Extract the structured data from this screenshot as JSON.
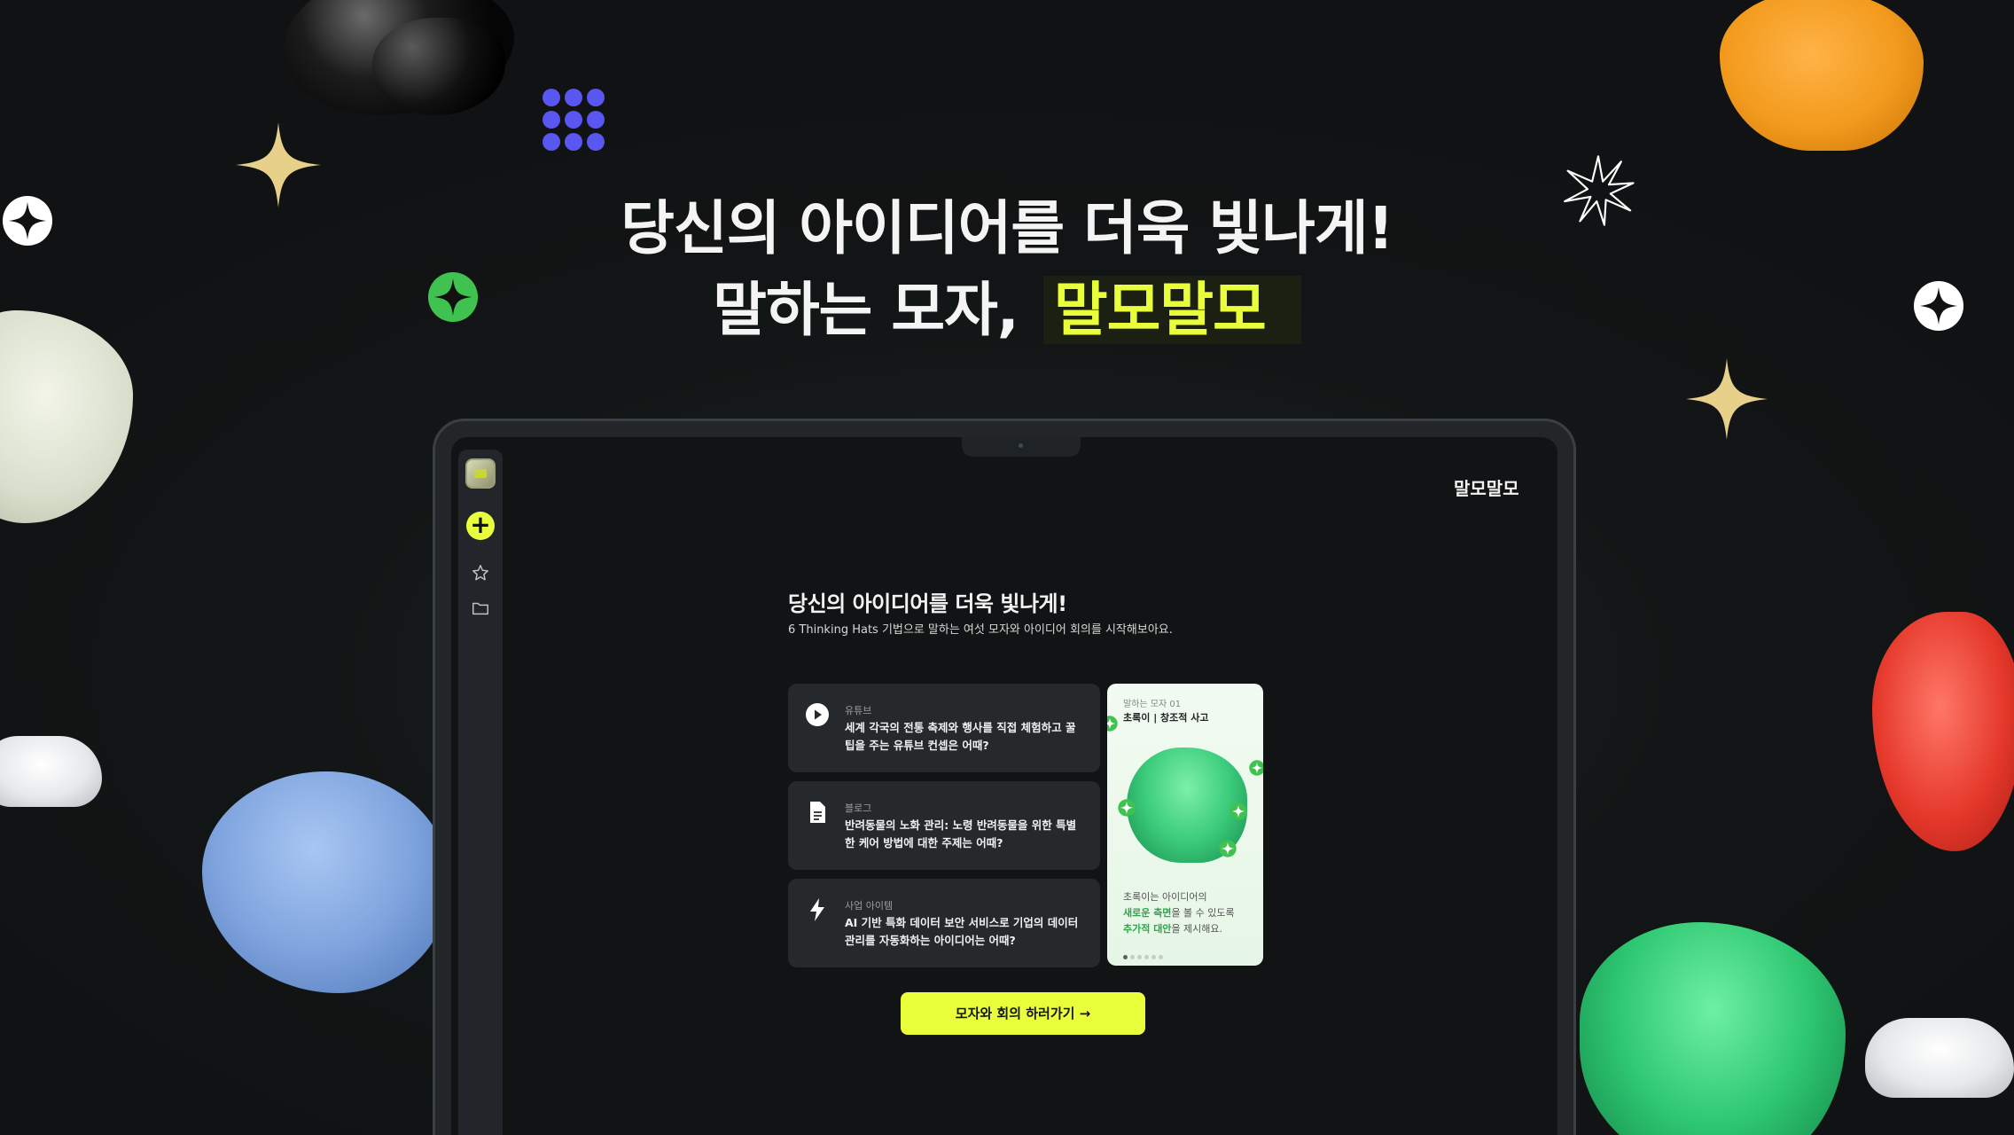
{
  "hero": {
    "line1": "당신의 아이디어를 더욱 빛나게!",
    "line2_prefix": "말하는 모자, ",
    "line2_highlight": "말모말모"
  },
  "app": {
    "brand": "말모말모",
    "title": "당신의 아이디어를 더욱 빛나게!",
    "subtitle": "6 Thinking Hats 기법으로 말하는 여섯 모자와 아이디어 회의를 시작해보아요.",
    "cards": [
      {
        "icon": "play-icon",
        "category": "유튜브",
        "text": "세계 각국의 전통 축제와 행사를 직접 체험하고 꿀팁을 주는 유튜브 컨셉은 어때?"
      },
      {
        "icon": "document-icon",
        "category": "블로그",
        "text": "반려동물의 노화 관리: 노령 반려동물을 위한 특별한 케어 방법에 대한 주제는 어때?"
      },
      {
        "icon": "lightning-icon",
        "category": "사업 아이템",
        "text": "AI 기반 특화 데이터 보안 서비스로 기업의 데이터 관리를 자동화하는 아이디어는 어때?"
      }
    ],
    "hat_card": {
      "label": "말하는 모자 01",
      "title": "초록이 | 창조적 사고",
      "desc_intro": "초록이는 아이디어의",
      "desc_bold1": "새로운 측면",
      "desc_mid": "을 볼 수 있도록",
      "desc_bold2": "추가적 대안",
      "desc_end": "을 제시해요.",
      "page_count": 6,
      "active_page": 1
    },
    "cta_label": "모자와 회의 하러가기 →"
  },
  "colors": {
    "accent": "#e9ff3c",
    "green": "#2aa84a",
    "purple": "#5956f2",
    "gold": "#e6d08a"
  }
}
